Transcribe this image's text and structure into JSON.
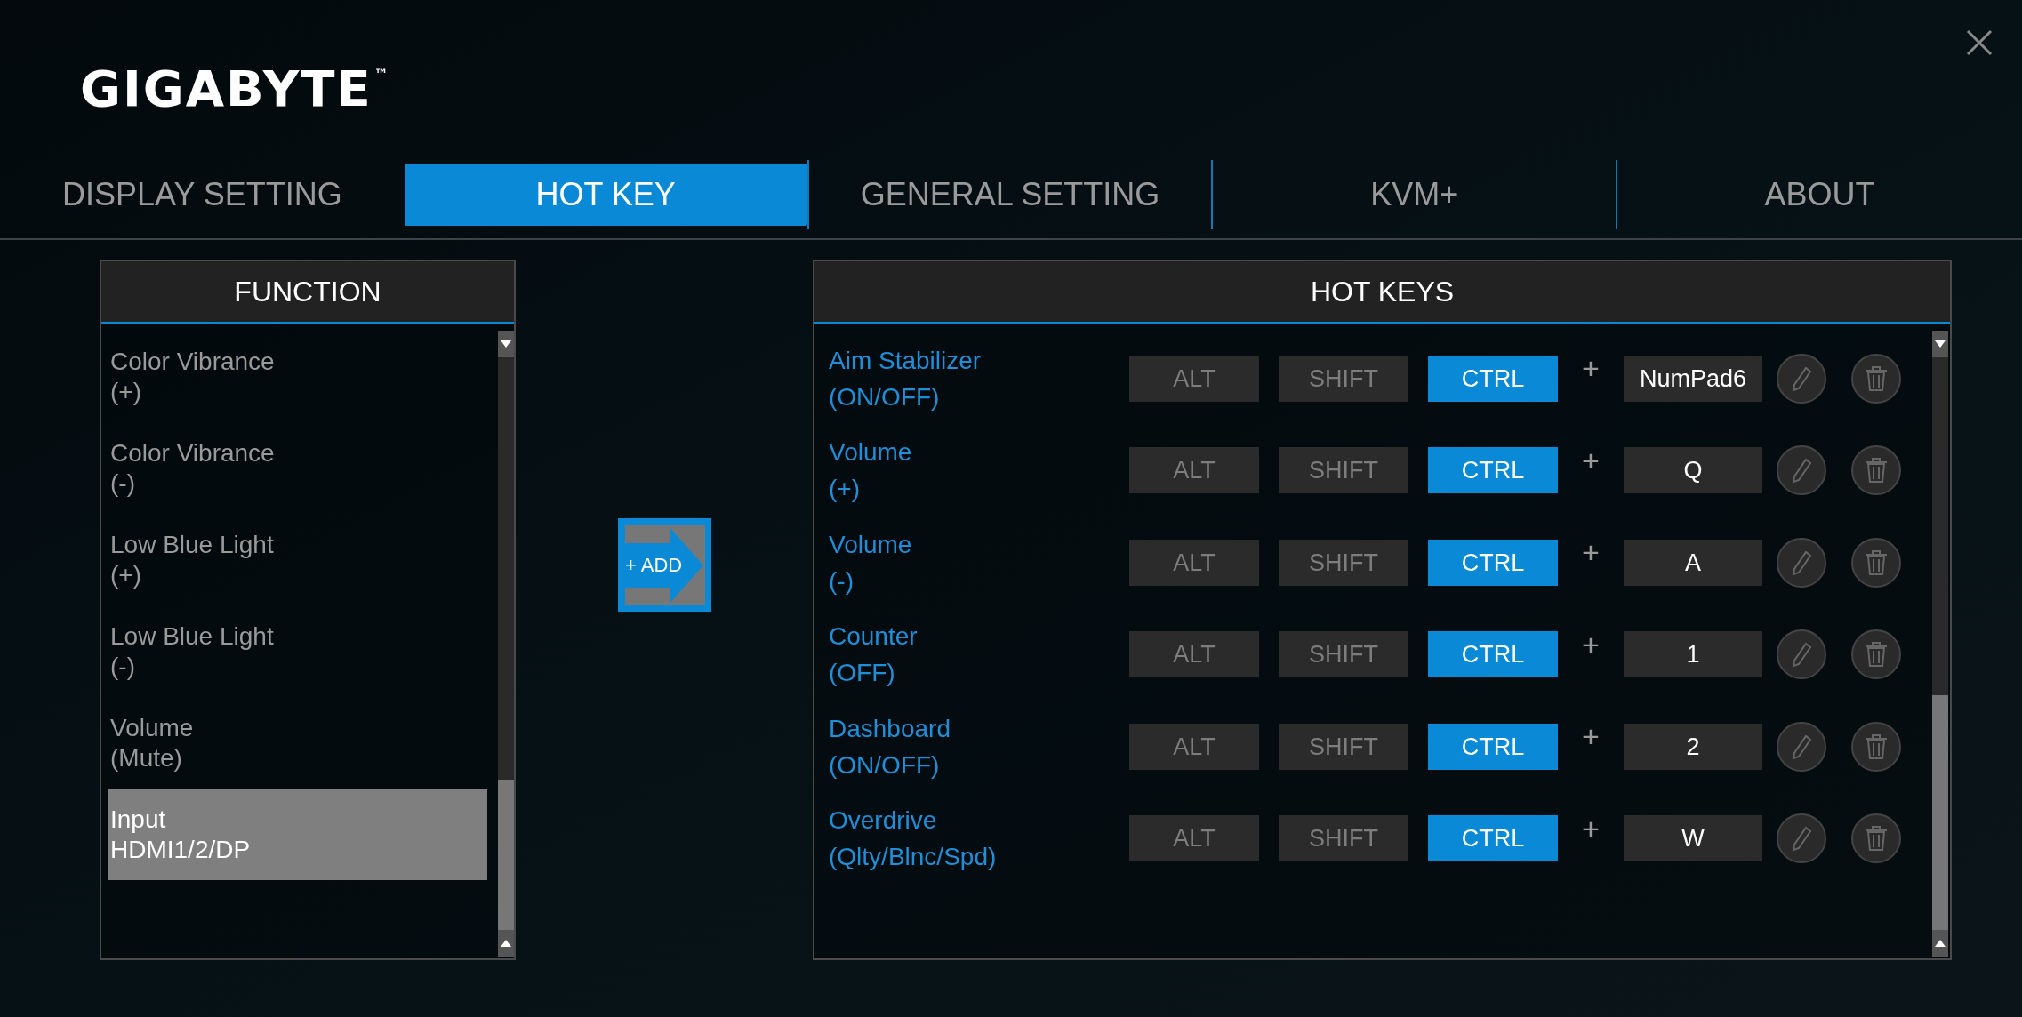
{
  "logo": {
    "text": "GIGABYTE",
    "mark": "™"
  },
  "tabs": [
    {
      "label": "DISPLAY SETTING",
      "selected": false
    },
    {
      "label": "HOT KEY",
      "selected": true
    },
    {
      "label": "GENERAL SETTING",
      "selected": false
    },
    {
      "label": "KVM+",
      "selected": false
    },
    {
      "label": "ABOUT",
      "selected": false
    }
  ],
  "function_panel": {
    "title": "FUNCTION",
    "items": [
      {
        "lines": [
          "Color Vibrance",
          "(+)"
        ],
        "selected": false
      },
      {
        "lines": [
          "Color Vibrance",
          "(-)"
        ],
        "selected": false
      },
      {
        "lines": [
          "Low Blue Light",
          "(+)"
        ],
        "selected": false
      },
      {
        "lines": [
          "Low Blue Light",
          "(-)"
        ],
        "selected": false
      },
      {
        "lines": [
          "Volume",
          "(Mute)"
        ],
        "selected": false
      },
      {
        "lines": [
          "Input",
          "HDMI1/2/DP"
        ],
        "selected": true
      }
    ]
  },
  "add_button": {
    "label": "+ ADD"
  },
  "hotkeys_panel": {
    "title": "HOT KEYS",
    "rows": [
      {
        "lines": [
          "Aim Stabilizer",
          "(ON/OFF)"
        ],
        "modifiers": [
          {
            "label": "ALT",
            "on": false
          },
          {
            "label": "SHIFT",
            "on": false
          },
          {
            "label": "CTRL",
            "on": true
          }
        ],
        "plus": "+",
        "key": "NumPad6"
      },
      {
        "lines": [
          "Volume",
          "(+)"
        ],
        "modifiers": [
          {
            "label": "ALT",
            "on": false
          },
          {
            "label": "SHIFT",
            "on": false
          },
          {
            "label": "CTRL",
            "on": true
          }
        ],
        "plus": "+",
        "key": "Q"
      },
      {
        "lines": [
          "Volume",
          "(-)"
        ],
        "modifiers": [
          {
            "label": "ALT",
            "on": false
          },
          {
            "label": "SHIFT",
            "on": false
          },
          {
            "label": "CTRL",
            "on": true
          }
        ],
        "plus": "+",
        "key": "A"
      },
      {
        "lines": [
          "Counter",
          "(OFF)"
        ],
        "modifiers": [
          {
            "label": "ALT",
            "on": false
          },
          {
            "label": "SHIFT",
            "on": false
          },
          {
            "label": "CTRL",
            "on": true
          }
        ],
        "plus": "+",
        "key": "1"
      },
      {
        "lines": [
          "Dashboard",
          "(ON/OFF)"
        ],
        "modifiers": [
          {
            "label": "ALT",
            "on": false
          },
          {
            "label": "SHIFT",
            "on": false
          },
          {
            "label": "CTRL",
            "on": true
          }
        ],
        "plus": "+",
        "key": "2"
      },
      {
        "lines": [
          "Overdrive",
          "(Qlty/Blnc/Spd)"
        ],
        "modifiers": [
          {
            "label": "ALT",
            "on": false
          },
          {
            "label": "SHIFT",
            "on": false
          },
          {
            "label": "CTRL",
            "on": true
          }
        ],
        "plus": "+",
        "key": "W"
      }
    ]
  }
}
